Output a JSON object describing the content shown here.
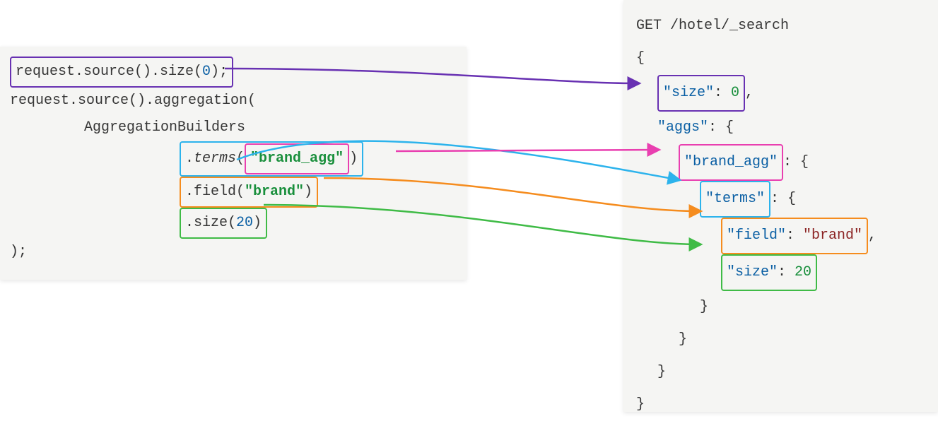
{
  "left": {
    "line1_prefix": "request.source().size(",
    "line1_num": "0",
    "line1_suffix": ");",
    "line2": "request.source().aggregation(",
    "line3": "AggregationBuilders",
    "line4_prefix": ".",
    "line4_method": "terms",
    "line4_paren_open": "(",
    "line4_arg": "\"brand_agg\"",
    "line4_paren_close": ")",
    "line5_prefix": ".field(",
    "line5_arg": "\"brand\"",
    "line5_suffix": ")",
    "line6_prefix": ".size(",
    "line6_num": "20",
    "line6_suffix": ")",
    "line7": ");"
  },
  "right": {
    "line1": "GET /hotel/_search",
    "line2": "{",
    "line3_key": "\"size\"",
    "line3_colon": ": ",
    "line3_val": "0",
    "line3_comma": ",",
    "line4_key": "\"aggs\"",
    "line4_rest": ": {",
    "line5_key": "\"brand_agg\"",
    "line5_rest": ": {",
    "line6_key": "\"terms\"",
    "line6_rest": ": {",
    "line7_key": "\"field\"",
    "line7_colon": ": ",
    "line7_val": "\"brand\"",
    "line7_comma": ",",
    "line8_key": "\"size\"",
    "line8_colon": ": ",
    "line8_val": "20",
    "line9": "}",
    "line10": "}",
    "line11": "}",
    "line12": "}"
  },
  "arrows": {
    "purple": {
      "color": "#6831b2"
    },
    "magenta": {
      "color": "#e93fb0"
    },
    "cyan": {
      "color": "#2cb3ec"
    },
    "orange": {
      "color": "#f58c1e"
    },
    "green": {
      "color": "#3fbb46"
    }
  }
}
